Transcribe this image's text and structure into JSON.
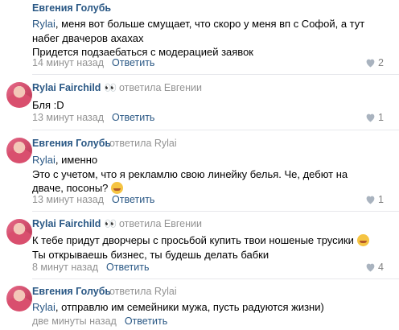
{
  "comments": [
    {
      "author": "Евгения Голубь",
      "eyes": "",
      "reply_to": "",
      "mention": "Rylai",
      "lines": [
        ", меня вот больше смущает, что скоро у меня вп с Софой, а тут",
        "набег двачеров ахахах",
        "Придется подзаебаться с модерацией заявок"
      ],
      "time": "14 минут назад",
      "reply": "Ответить",
      "likes": "2"
    },
    {
      "author": "Rylai Fairchild",
      "eyes": "👀",
      "reply_to": "ответила Евгении",
      "mention": "",
      "lines": [
        "Бля :D"
      ],
      "time": "13 минут назад",
      "reply": "Ответить",
      "likes": "1"
    },
    {
      "author": "Евгения Голубь",
      "eyes": "",
      "reply_to": "ответила Rylai",
      "mention": "Rylai",
      "lines": [
        ", именно",
        "Это с учетом, что я рекламлю свою линейку белья. Че, дебют на",
        "дваче, посоны?"
      ],
      "time": "13 минут назад",
      "reply": "Ответить",
      "likes": "1"
    },
    {
      "author": "Rylai Fairchild",
      "eyes": "👀",
      "reply_to": "ответила Евгении",
      "mention": "",
      "lines": [
        "К тебе придут дворчеры с просьбой купить твои ношеные трусики",
        "Ты открываешь бизнес, ты будешь делать бабки"
      ],
      "time": "8 минут назад",
      "reply": "Ответить",
      "likes": "4"
    },
    {
      "author": "Евгения Голубь",
      "eyes": "",
      "reply_to": "ответила Rylai",
      "mention": "Rylai",
      "lines": [
        ", отправлю им семейники мужа, пусть радуются жизни)"
      ],
      "time": "две минуты назад",
      "reply": "Ответить",
      "likes": ""
    }
  ],
  "colors": {
    "link": "#2a5885",
    "meta": "#939393",
    "divider": "#e7e8ec"
  },
  "icons": {
    "like": "heart-icon",
    "emoji": "smiling-face-emoji"
  }
}
